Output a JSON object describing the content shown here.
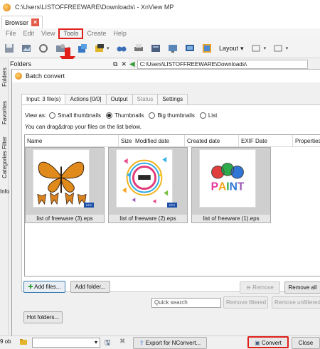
{
  "window": {
    "title": "C:\\Users\\LISTOFFREEWARE\\Downloads\\ - XnView MP"
  },
  "browser_tab": {
    "label": "Browser"
  },
  "menu": [
    "File",
    "Edit",
    "View",
    "Tools",
    "Create",
    "Help"
  ],
  "toolbar": {
    "layout_label": "Layout"
  },
  "folders_panel": {
    "title": "Folders"
  },
  "path": "C:\\Users\\LISTOFFREEWARE\\Downloads\\",
  "side_tabs": [
    "Folders",
    "Favorites",
    "Categories Filter"
  ],
  "side_info": "Info",
  "dialog": {
    "title": "Batch convert",
    "tabs": [
      "Input: 3 file(s)",
      "Actions [0/0]",
      "Output",
      "Status",
      "Settings"
    ],
    "view_as_label": "View as:",
    "view_options": [
      "Small thumbnails",
      "Thumbnails",
      "Big thumbnails",
      "List"
    ],
    "view_selected": "Thumbnails",
    "hint": "You can drag&drop your files on the list below.",
    "columns": [
      "Name",
      "Size",
      "Modified date",
      "Created date",
      "EXIF Date",
      "Properties"
    ],
    "files": [
      {
        "name": "list of freeware (3).eps",
        "badge": "EPS"
      },
      {
        "name": "list of freeware (2).eps",
        "badge": "EPS"
      },
      {
        "name": "list of freeware (1).eps",
        "badge": ""
      }
    ],
    "buttons": {
      "add_files": "Add files...",
      "add_folder": "Add folder...",
      "remove": "Remove",
      "remove_all": "Remove all",
      "quick_search": "Quick search",
      "remove_filtered": "Remove filtered",
      "remove_unfiltered": "Remove unfiltered",
      "hot_folders": "Hot folders...",
      "export": "Export for NConvert...",
      "convert": "Convert",
      "close": "Close"
    }
  },
  "status": {
    "left": "9 ob"
  },
  "colors": {
    "highlight_red": "#e0201b",
    "accent_blue": "#3c7fb1"
  }
}
